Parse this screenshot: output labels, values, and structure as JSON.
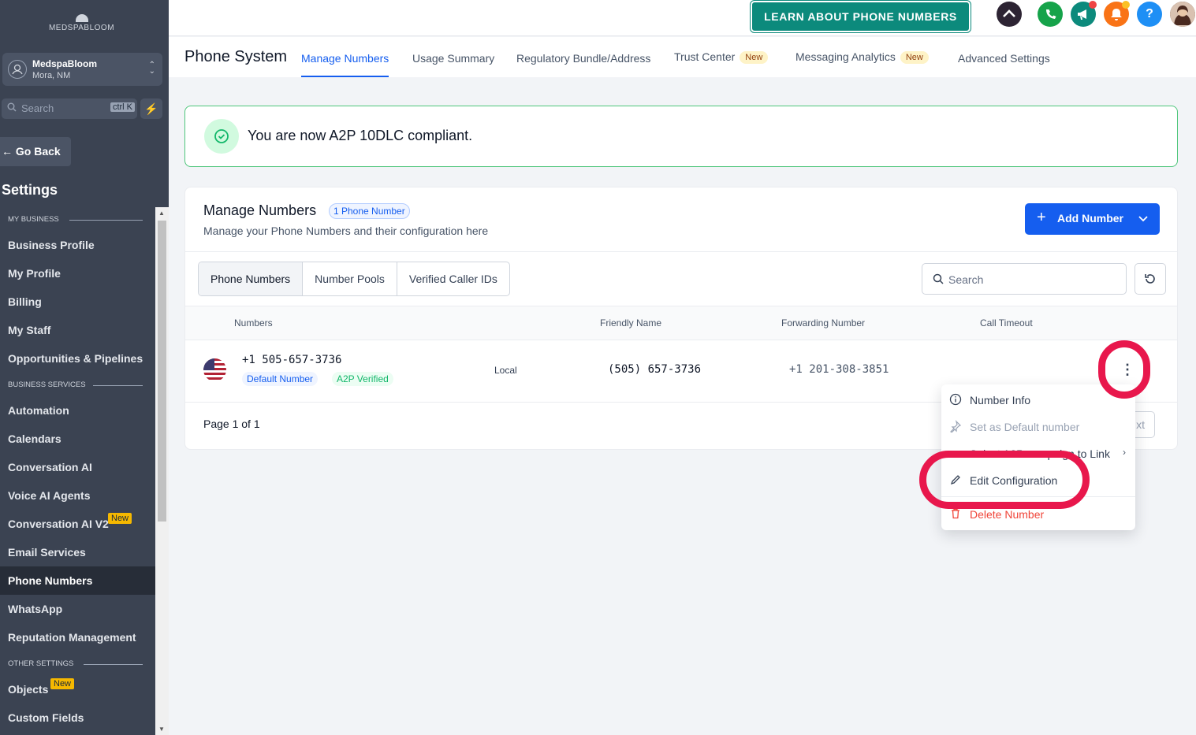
{
  "brand": {
    "logo_text": "MEDSPABLOOM"
  },
  "account": {
    "name": "MedspaBloom",
    "location": "Mora, NM"
  },
  "sidebar_search": {
    "placeholder": "Search",
    "shortcut": "ctrl K"
  },
  "nav": {
    "go_back": "Go Back",
    "settings_title": "Settings",
    "sections": {
      "my_business": "MY BUSINESS",
      "business_services": "BUSINESS SERVICES",
      "other_settings": "OTHER SETTINGS"
    },
    "items": {
      "business_profile": "Business Profile",
      "my_profile": "My Profile",
      "billing": "Billing",
      "my_staff": "My Staff",
      "opportunities": "Opportunities & Pipelines",
      "automation": "Automation",
      "calendars": "Calendars",
      "conversation_ai": "Conversation AI",
      "voice_ai_agents": "Voice AI Agents",
      "conversation_ai_v2": "Conversation AI V2",
      "email_services": "Email Services",
      "phone_numbers": "Phone Numbers",
      "whatsapp": "WhatsApp",
      "reputation": "Reputation Management",
      "objects": "Objects",
      "custom_fields": "Custom Fields"
    },
    "new_badge": "New"
  },
  "topbar": {
    "learn_button": "LEARN ABOUT PHONE NUMBERS",
    "help_label": "?",
    "colors": {
      "teal": "#0c8a7c",
      "green": "#16a34a",
      "orange": "#f97316",
      "blue": "#1e8ff5",
      "dark": "#2d2433"
    }
  },
  "page": {
    "title": "Phone System",
    "tabs": {
      "manage_numbers": "Manage Numbers",
      "usage_summary": "Usage Summary",
      "regulatory": "Regulatory Bundle/Address",
      "trust_center": "Trust Center",
      "messaging_analytics": "Messaging Analytics",
      "advanced_settings": "Advanced Settings"
    },
    "new_badge": "New"
  },
  "banner": {
    "text": "You are now A2P 10DLC compliant."
  },
  "manage": {
    "title": "Manage Numbers",
    "count_badge": "1 Phone Number",
    "subtitle": "Manage your Phone Numbers and their configuration here",
    "add_button": "Add Number",
    "segments": {
      "phone_numbers": "Phone Numbers",
      "number_pools": "Number Pools",
      "verified_caller_ids": "Verified Caller IDs"
    },
    "search_placeholder": "Search",
    "columns": {
      "numbers": "Numbers",
      "friendly_name": "Friendly Name",
      "forwarding_number": "Forwarding Number",
      "call_timeout": "Call Timeout"
    },
    "row": {
      "number": "+1 505-657-3736",
      "default_badge": "Default Number",
      "a2p_badge": "A2P Verified",
      "type": "Local",
      "friendly_name": "(505) 657-3736",
      "forwarding": "+1 201-308-3851",
      "call_timeout": ""
    },
    "pagination": "Page 1 of 1",
    "next_partial": "xt"
  },
  "menu": {
    "number_info": "Number Info",
    "set_default": "Set as Default number",
    "select_a2p": "Select A2P campaign to Link",
    "edit_configuration": "Edit Configuration",
    "delete_number": "Delete Number"
  }
}
